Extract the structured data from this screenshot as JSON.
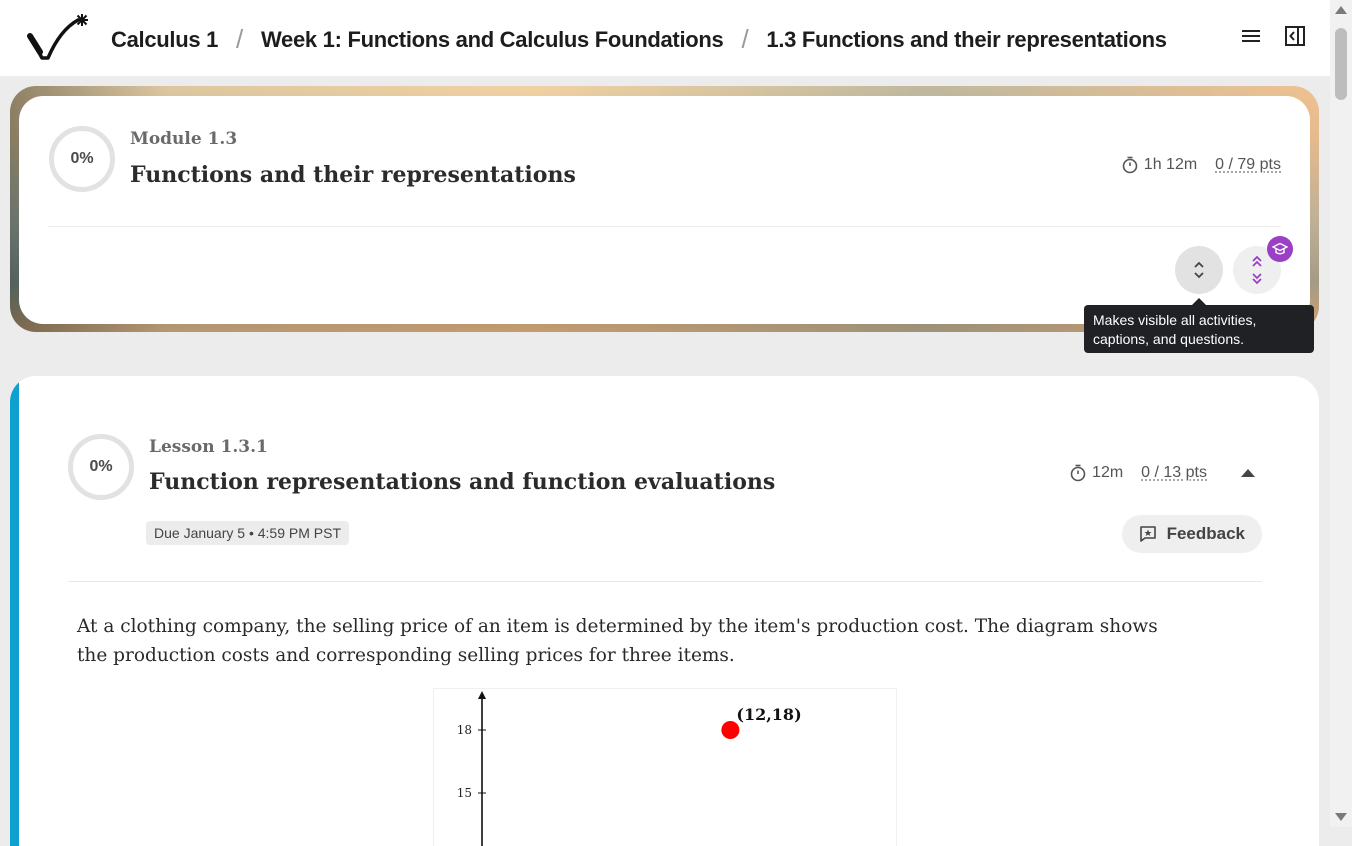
{
  "header": {
    "breadcrumbs": [
      {
        "label": "Calculus 1"
      },
      {
        "label": "Week 1: Functions and Calculus Foundations"
      },
      {
        "label": "1.3 Functions and their representations"
      }
    ],
    "icons": [
      "logo",
      "menu-icon",
      "sidebar-toggle-icon"
    ]
  },
  "module": {
    "progress": "0%",
    "eyebrow": "Module 1.3",
    "title": "Functions and their representations",
    "duration": "1h 12m",
    "points": "0 / 79 pts",
    "tooltip": "Makes visible all activities, captions, and questions.",
    "badge_icon": "graduation-cap-icon",
    "badge_color": "#9b3fc6"
  },
  "lesson": {
    "progress": "0%",
    "eyebrow": "Lesson 1.3.1",
    "title": "Function representations and function evaluations",
    "duration": "12m",
    "points": "0 / 13 pts",
    "due": "Due January 5 • 4:59 PM PST",
    "feedback_label": "Feedback",
    "accent_color": "#0ea0cf",
    "body": "At a clothing company, the selling price of an item is determined by the item's production cost. The diagram shows the production costs and corresponding selling prices for three items."
  },
  "chart_data": {
    "type": "scatter",
    "points": [
      {
        "x": 12,
        "y": 18,
        "label": "(12,18)"
      }
    ],
    "y_ticks": [
      "18",
      "15"
    ],
    "point_color": "#ff0000"
  }
}
